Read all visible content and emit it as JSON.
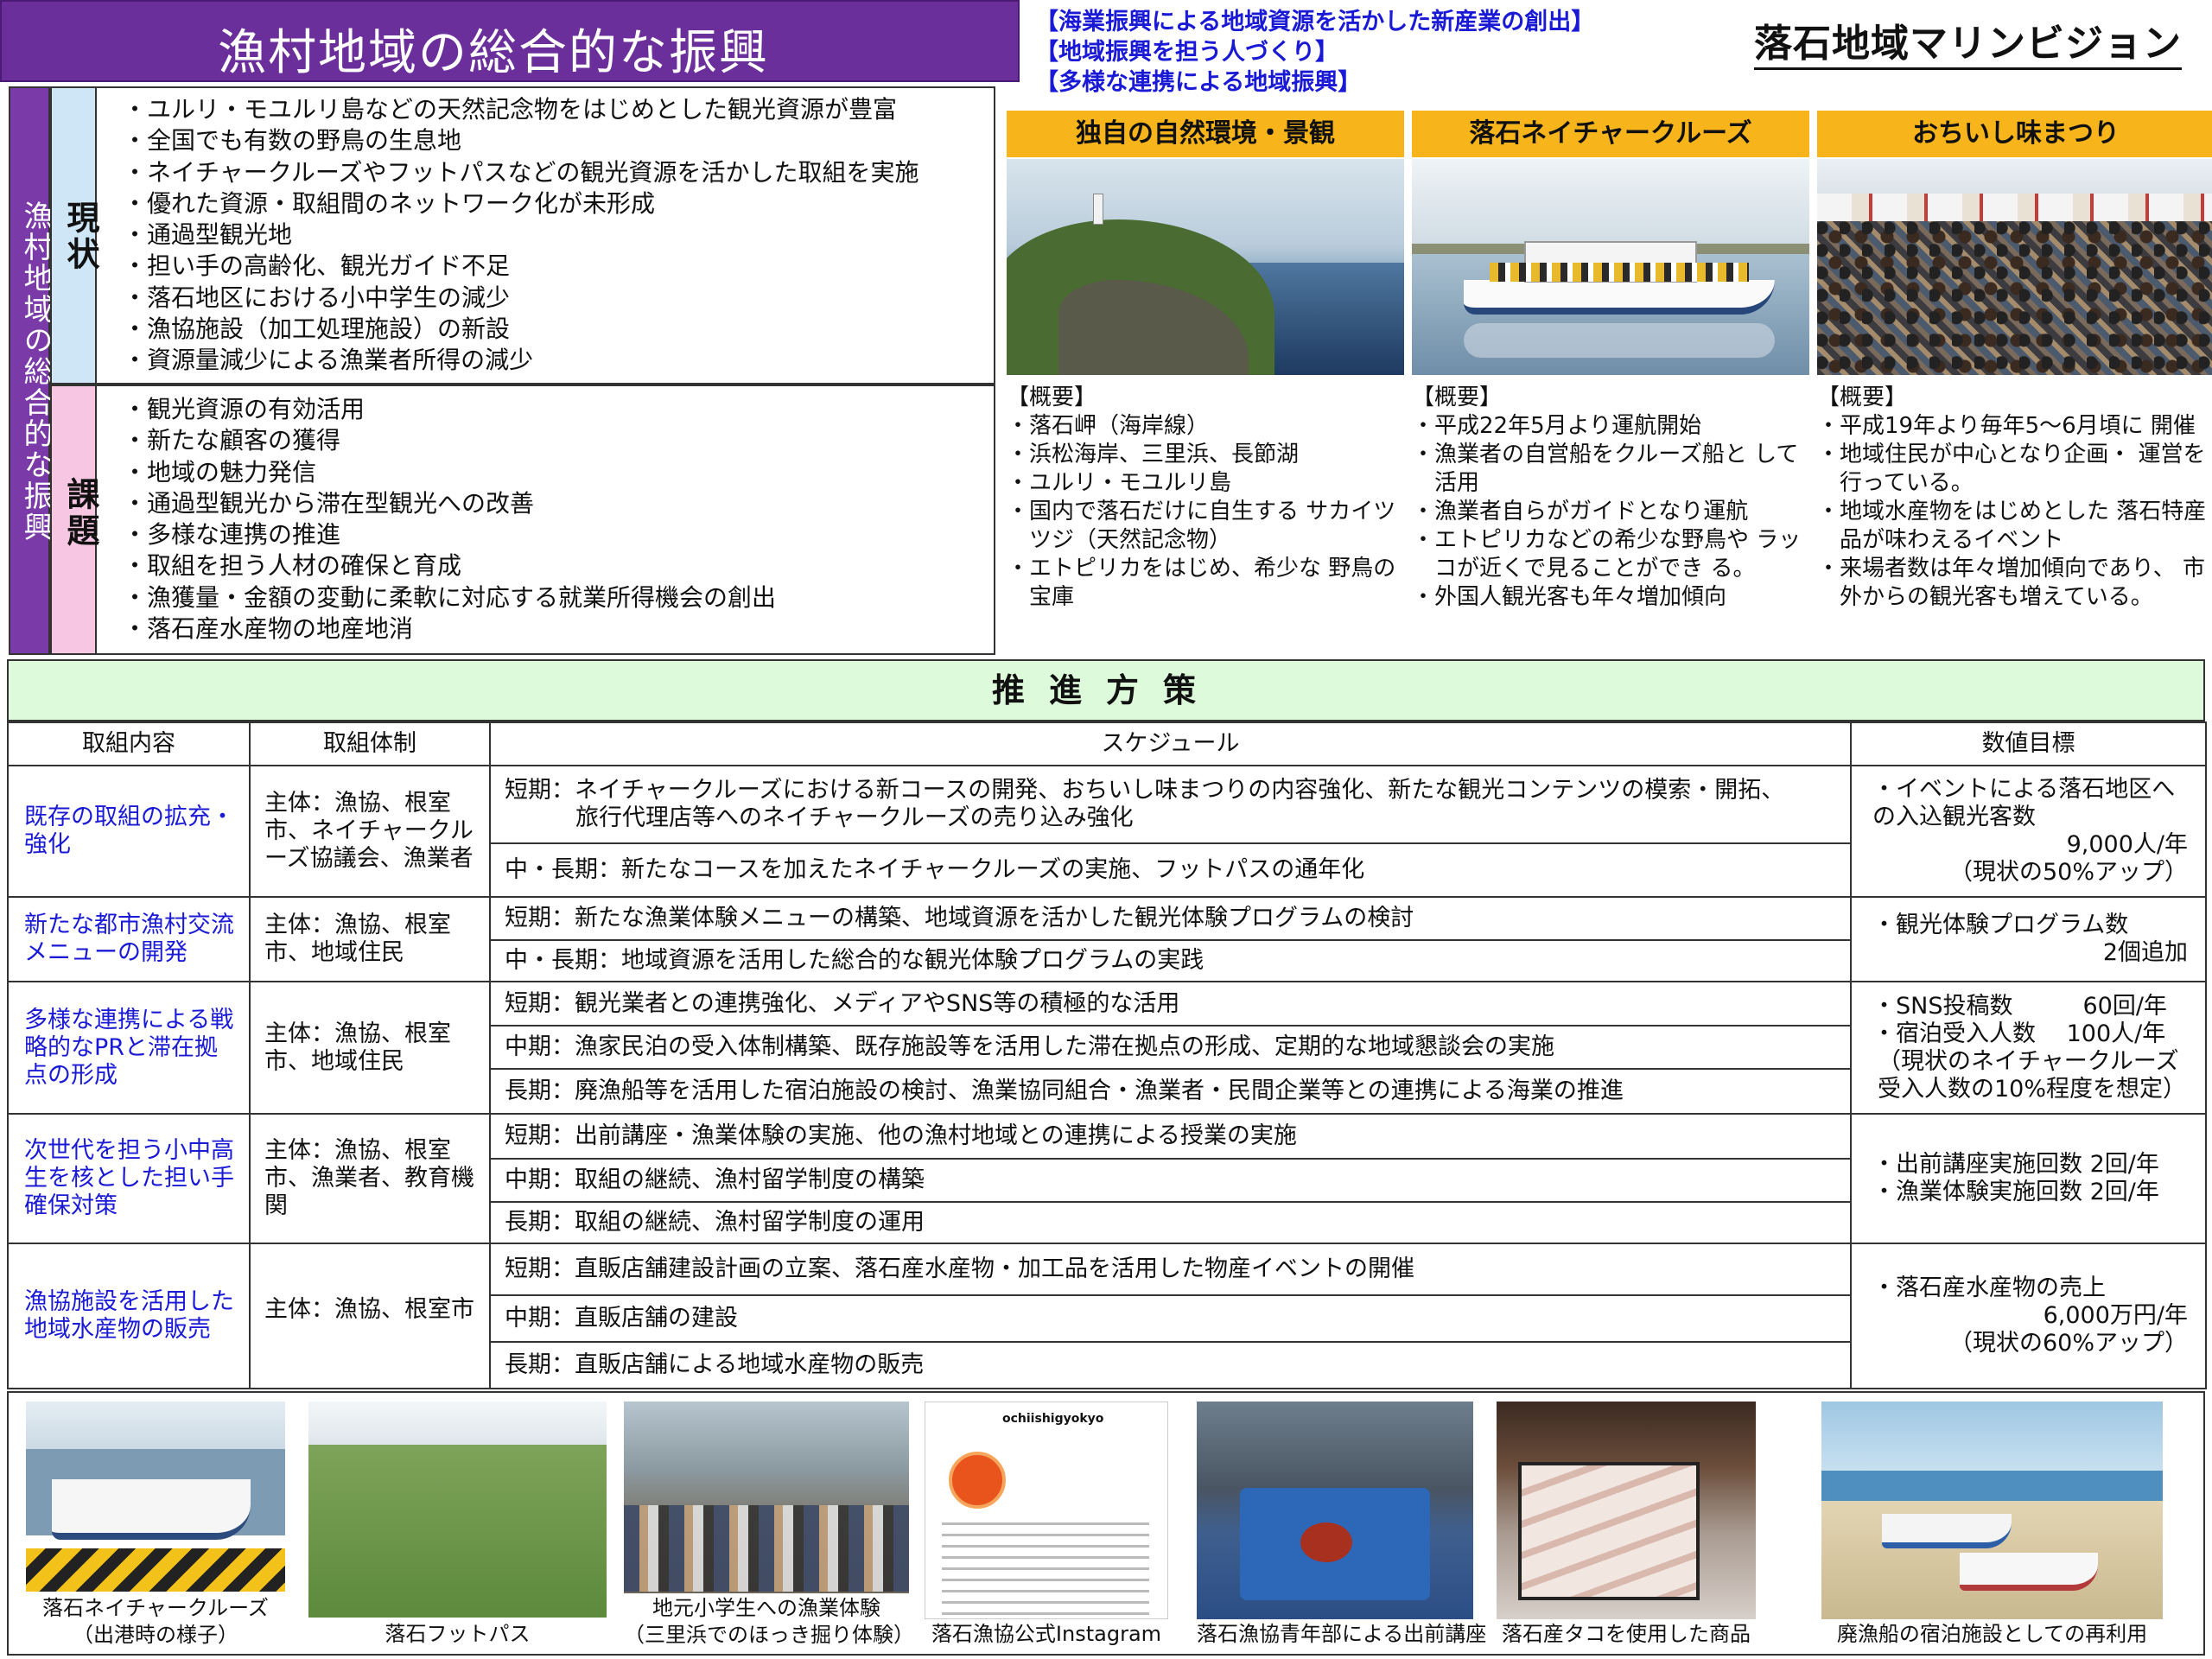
{
  "header": {
    "title": "漁村地域の総合的な振興",
    "themes": [
      "【海業振興による地域資源を活かした新産業の創出】",
      "【地域振興を担う人づくり】",
      "【多様な連携による地域振興】"
    ],
    "vision": "落石地域マリンビジョン"
  },
  "status": {
    "side_label": "漁村地域の総合的な振興",
    "genjo_label": "現状",
    "kadai_label": "課題",
    "genjo_items": [
      "・ユルリ・モユルリ島などの天然記念物をはじめとした観光資源が豊富",
      "・全国でも有数の野鳥の生息地",
      "・ネイチャークルーズやフットパスなどの観光資源を活かした取組を実施",
      "・優れた資源・取組間のネットワーク化が未形成",
      "・通過型観光地",
      "・担い手の高齢化、観光ガイド不足",
      "・落石地区における小中学生の減少",
      "・漁協施設（加工処理施設）の新設",
      "・資源量減少による漁業者所得の減少"
    ],
    "kadai_items": [
      "・観光資源の有効活用",
      "・新たな顧客の獲得",
      "・地域の魅力発信",
      "・通過型観光から滞在型観光への改善",
      "・多様な連携の推進",
      "・取組を担う人材の確保と育成",
      "・漁獲量・金額の変動に柔軟に対応する就業所得機会の創出",
      "・落石産水産物の地産地消"
    ]
  },
  "features": [
    {
      "title": "独自の自然環境・景観",
      "overview_label": "【概要】",
      "items": [
        "・落石岬（海岸線）",
        "・浜松海岸、三里浜、長節湖",
        "・ユルリ・モユルリ島",
        "・国内で落石だけに自生する サカイツツジ（天然記念物）",
        "・エトピリカをはじめ、希少な 野鳥の宝庫"
      ]
    },
    {
      "title": "落石ネイチャークルーズ",
      "overview_label": "【概要】",
      "items": [
        "・平成22年5月より運航開始",
        "・漁業者の自営船をクルーズ船と して活用",
        "・漁業者自らがガイドとなり運航",
        "・エトピリカなどの希少な野鳥や ラッコが近くで見ることができ る。",
        "・外国人観光客も年々増加傾向"
      ]
    },
    {
      "title": "おちいし味まつり",
      "overview_label": "【概要】",
      "items": [
        "・平成19年より毎年5～6月頃に 開催",
        "・地域住民が中心となり企画・ 運営を行っている。",
        "・地域水産物をはじめとした 落石特産品が味わえるイベント",
        "・来場者数は年々増加傾向であり、 市外からの観光客も増えている。"
      ]
    }
  ],
  "promotion": {
    "title": "推進方策",
    "columns": [
      "取組内容",
      "取組体制",
      "スケジュール",
      "数値目標"
    ],
    "rows": [
      {
        "content": "既存の取組の拡充・強化",
        "body": "主体：漁協、根室市、ネイチャークルーズ協議会、漁業者",
        "schedule": [
          {
            "label": "短期：",
            "text": "ネイチャークルーズにおける新コースの開発、おちいし味まつりの内容強化、新たな観光コンテンツの模索・開拓、",
            "text2": "旅行代理店等へのネイチャークルーズの売り込み強化"
          },
          {
            "label": "中・長期：",
            "text": "新たなコースを加えたネイチャークルーズの実施、フットパスの通年化"
          }
        ],
        "target": [
          "・イベントによる落石地区への入込観光客数",
          "9,000人/年",
          "（現状の50%アップ）"
        ]
      },
      {
        "content": "新たな都市漁村交流メニューの開発",
        "body": "主体：漁協、根室市、地域住民",
        "schedule": [
          {
            "label": "短期：",
            "text": "新たな漁業体験メニューの構築、地域資源を活かした観光体験プログラムの検討"
          },
          {
            "label": "中・長期：",
            "text": "地域資源を活用した総合的な観光体験プログラムの実践"
          }
        ],
        "target": [
          "・観光体験プログラム数",
          "2個追加"
        ]
      },
      {
        "content": "多様な連携による戦略的なPRと滞在拠点の形成",
        "body": "主体：漁協、根室市、地域住民",
        "schedule": [
          {
            "label": "短期：",
            "text": "観光業者との連携強化、メディアやSNS等の積極的な活用"
          },
          {
            "label": "中期：",
            "text": "漁家民泊の受入体制構築、既存施設等を活用した滞在拠点の形成、定期的な地域懇談会の実施"
          },
          {
            "label": "長期：",
            "text": "廃漁船等を活用した宿泊施設の検討、漁業協同組合・漁業者・民間企業等との連携による海業の推進"
          }
        ],
        "target": [
          "・SNS投稿数　　　60回/年",
          "・宿泊受入人数　 100人/年",
          "（現状のネイチャークルーズ受入人数の10%程度を想定）"
        ]
      },
      {
        "content": "次世代を担う小中高生を核とした担い手確保対策",
        "body": "主体：漁協、根室市、漁業者、教育機関",
        "schedule": [
          {
            "label": "短期：",
            "text": "出前講座・漁業体験の実施、他の漁村地域との連携による授業の実施"
          },
          {
            "label": "中期：",
            "text": "取組の継続、漁村留学制度の構築"
          },
          {
            "label": "長期：",
            "text": "取組の継続、漁村留学制度の運用"
          }
        ],
        "target": [
          "・出前講座実施回数 2回/年",
          "・漁業体験実施回数 2回/年"
        ]
      },
      {
        "content": "漁協施設を活用した地域水産物の販売",
        "body": "主体：漁協、根室市",
        "schedule": [
          {
            "label": "短期：",
            "text": "直販店舗建設計画の立案、落石産水産物・加工品を活用した物産イベントの開催"
          },
          {
            "label": "中期：",
            "text": "直販店舗の建設"
          },
          {
            "label": "長期：",
            "text": "直販店舗による地域水産物の販売"
          }
        ],
        "target": [
          "・落石産水産物の売上",
          "6,000万円/年",
          "（現状の60%アップ）"
        ]
      }
    ]
  },
  "gallery": [
    {
      "caption": "落石ネイチャークルーズ",
      "caption2": "（出港時の様子）"
    },
    {
      "caption": "落石フットパス"
    },
    {
      "caption": "地元小学生への漁業体験",
      "caption2": "（三里浜でのほっき掘り体験）"
    },
    {
      "caption": "落石漁協公式Instagram",
      "account": "ochiishigyokyo"
    },
    {
      "caption": "落石漁協青年部による出前講座"
    },
    {
      "caption": "落石産タコを使用した商品"
    },
    {
      "caption": "廃漁船の宿泊施設としての再利用"
    }
  ]
}
